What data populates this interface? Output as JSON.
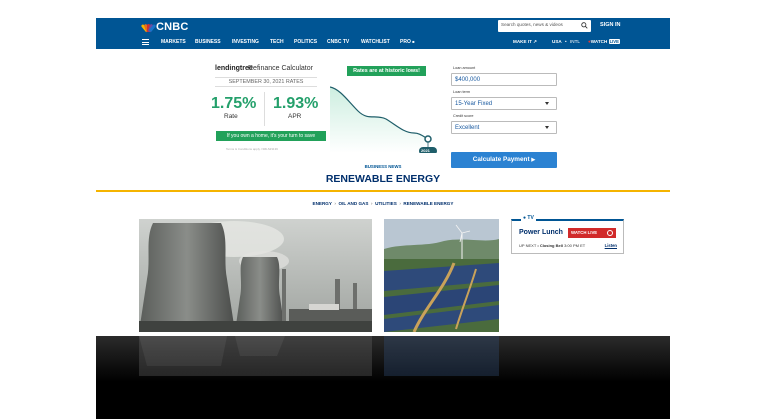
{
  "header": {
    "logo": "CNBC",
    "search_placeholder": "Search quotes, news & videos",
    "signin": "SIGN IN",
    "nav": [
      "MARKETS",
      "BUSINESS",
      "INVESTING",
      "TECH",
      "POLITICS",
      "CNBC TV",
      "WATCHLIST",
      "PRO"
    ],
    "make_it": "MAKE IT",
    "edition_usa": "USA",
    "edition_intl": "INTL",
    "watch": "WATCH",
    "live": "LIVE"
  },
  "ad": {
    "brand": "lendingtree",
    "title": "Refinance Calculator",
    "date": "SEPTEMBER 30, 2021 RATES",
    "rate_value": "1.75%",
    "rate_label": "Rate",
    "apr_value": "1.93%",
    "apr_label": "APR",
    "cta": "If you own a home, it's your turn to save",
    "fine_print": "Terms & Conditions apply. NMLS#1136",
    "historic_badge": "Rates are at historic lows!",
    "chart_marker": "2021",
    "loan_amount_label": "Loan amount",
    "loan_amount": "$400,000",
    "loan_term_label": "Loan term",
    "loan_term": "15-Year Fixed",
    "credit_label": "Credit score",
    "credit": "Excellent",
    "calc_button": "Calculate Payment"
  },
  "section": {
    "kicker": "BUSINESS NEWS",
    "title": "RENEWABLE ENERGY",
    "crumbs": [
      "ENERGY",
      "OIL AND GAS",
      "UTILITIES",
      "RENEWABLE ENERGY"
    ]
  },
  "tv": {
    "badge": "TV",
    "show": "Power Lunch",
    "watch_live": "WATCH LIVE",
    "up_next_label": "UP NEXT",
    "up_next_show": "Closing Bell",
    "up_next_time": "3:00 PM ET",
    "listen": "Listen"
  },
  "colors": {
    "brand_blue": "#005594",
    "accent_yellow": "#f5b400",
    "rate_green": "#24a06b",
    "button_blue": "#2b82d2",
    "live_red": "#d12a2a"
  }
}
